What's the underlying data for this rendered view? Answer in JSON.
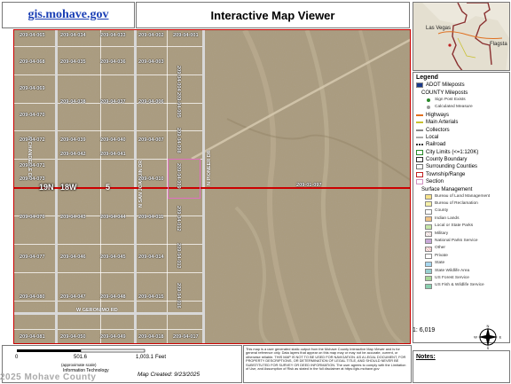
{
  "header": {
    "site_link": "gis.mohave.gov",
    "title": "Interactive Map Viewer"
  },
  "inset_map": {
    "labels": [
      "Las Vegas",
      "Flagsta"
    ]
  },
  "map": {
    "parcels": [
      {
        "id": "209-04-065"
      },
      {
        "id": "209-04-034"
      },
      {
        "id": "209-04-033"
      },
      {
        "id": "209-04-002"
      },
      {
        "id": "209-04-001"
      },
      {
        "id": "209-04-068"
      },
      {
        "id": "209-04-035"
      },
      {
        "id": "209-04-036"
      },
      {
        "id": "209-04-003"
      },
      {
        "id": "209-04-004"
      },
      {
        "id": "209-04-069"
      },
      {
        "id": "209-04-038"
      },
      {
        "id": "209-04-037"
      },
      {
        "id": "209-04-006"
      },
      {
        "id": "209-04-005"
      },
      {
        "id": "209-04-070"
      },
      {
        "id": "209-04-039"
      },
      {
        "id": "209-04-007"
      },
      {
        "id": "209-04-008"
      },
      {
        "id": "209-04-072"
      },
      {
        "id": "209-04-039"
      },
      {
        "id": "209-04-040"
      },
      {
        "id": "209-04-007"
      },
      {
        "id": "209-04-071"
      },
      {
        "id": "209-04-042"
      },
      {
        "id": "209-04-041"
      },
      {
        "id": "209-04-009"
      },
      {
        "id": "209-04-073"
      },
      {
        "id": "209-04-010"
      },
      {
        "id": "209-04-076"
      },
      {
        "id": "209-04-043"
      },
      {
        "id": "209-04-044"
      },
      {
        "id": "209-04-011"
      },
      {
        "id": "209-04-012"
      },
      {
        "id": "209-04-077"
      },
      {
        "id": "209-04-046"
      },
      {
        "id": "209-04-045"
      },
      {
        "id": "209-04-014"
      },
      {
        "id": "209-04-013"
      },
      {
        "id": "209-04-080"
      },
      {
        "id": "209-04-047"
      },
      {
        "id": "209-04-048"
      },
      {
        "id": "209-04-015"
      },
      {
        "id": "209-04-016"
      },
      {
        "id": "209-04-081"
      },
      {
        "id": "209-04-050"
      },
      {
        "id": "209-04-049"
      },
      {
        "id": "209-04-018"
      },
      {
        "id": "209-04-017"
      },
      {
        "id": "209-01-097"
      }
    ],
    "township": "19N",
    "range": "18W",
    "section": "5",
    "roads": {
      "road1": "W GERONIMO RD",
      "road2": "N CHANDELLE DR",
      "road3": "N SAN JOAQUIN DR",
      "road4": "N PIONEER DR"
    }
  },
  "legend": {
    "title": "Legend",
    "items": [
      {
        "label": "ADOT Mileposts",
        "color": "#1a3a8a",
        "kind": "sq"
      },
      {
        "label": "COUNTY Mileposts",
        "color": "",
        "kind": "text"
      },
      {
        "label": "Sign Post Exists",
        "color": "#2a8a2a",
        "kind": "dot",
        "sub": true
      },
      {
        "label": "Calculated Measure",
        "color": "#9a9a9a",
        "kind": "dot",
        "sub": true
      },
      {
        "label": "Highways",
        "color": "#e07020",
        "kind": "line"
      },
      {
        "label": "Main Arterials",
        "color": "#c8c030",
        "kind": "line"
      },
      {
        "label": "Collectors",
        "color": "#8a8a8a",
        "kind": "line"
      },
      {
        "label": "Local",
        "color": "#aaaaaa",
        "kind": "line"
      },
      {
        "label": "Railroad",
        "color": "#333333",
        "kind": "rail"
      },
      {
        "label": "City Limits (<=1:120K)",
        "color": "#2a8a2a",
        "kind": "box"
      },
      {
        "label": "County Boundary",
        "color": "#333333",
        "kind": "box"
      },
      {
        "label": "Surrounding Counties",
        "color": "#777777",
        "kind": "box"
      },
      {
        "label": "Township/Range",
        "color": "#c02020",
        "kind": "box"
      },
      {
        "label": "Section",
        "color": "#d090c0",
        "kind": "box"
      },
      {
        "label": "Surface Management",
        "color": "",
        "kind": "text"
      },
      {
        "label": "Bureau of Land Management",
        "color": "#f6e28a",
        "kind": "sq",
        "sub": true
      },
      {
        "label": "Bureau of Reclamation",
        "color": "#f6f0a8",
        "kind": "sq",
        "sub": true
      },
      {
        "label": "County",
        "color": "#ffffff",
        "kind": "sq",
        "sub": true
      },
      {
        "label": "Indian Lands",
        "color": "#f2c488",
        "kind": "sq",
        "sub": true
      },
      {
        "label": "Local or State Parks",
        "color": "#c6e6a8",
        "kind": "sq",
        "sub": true
      },
      {
        "label": "Military",
        "color": "#e8d0d0",
        "kind": "hatch",
        "sub": true
      },
      {
        "label": "National Parks Service",
        "color": "#c8a8d8",
        "kind": "sq",
        "sub": true
      },
      {
        "label": "Other",
        "color": "#e8b0b0",
        "kind": "hatch",
        "sub": true
      },
      {
        "label": "Private",
        "color": "#ffffff",
        "kind": "sq",
        "sub": true
      },
      {
        "label": "State",
        "color": "#a8d8f0",
        "kind": "sq",
        "sub": true
      },
      {
        "label": "State Wildlife Area",
        "color": "#98d0d0",
        "kind": "sq",
        "sub": true
      },
      {
        "label": "US Forest Service",
        "color": "#a8d898",
        "kind": "sq",
        "sub": true
      },
      {
        "label": "US Fish & Wildlife Service",
        "color": "#8ad0b0",
        "kind": "sq",
        "sub": true
      }
    ]
  },
  "scale": {
    "ratio": "1: 6,019",
    "ticks": [
      "0",
      "501.6",
      "1,003.1"
    ],
    "unit": "Feet",
    "note": "(approximate scale)"
  },
  "footer": {
    "created": "Map Created: 9/23/2025",
    "org": "Information Technology",
    "watermark": "2025 Mohave County",
    "disclaimer": "This map is a user generated static output from the Mohave County Interactive Map Viewer and is for general reference only. Data layers that appear on this map may or may not be accurate, current, or otherwise reliable. THIS MAP IS NOT TO BE USED FOR NAVIGATION. AS A LEGAL DOCUMENT, FOR PROPERTY DESCRIPTIONS, OR DETERMINATION OF LEGAL TITLE, AND SHOULD NEVER BE SUBSTITUTED FOR SURVEY OR DEED INFORMATION. The user agrees to comply with the Limitation of Use, and Assumption of Risk as stated in the full disclaimer at https://gis.mohave.gov",
    "notes_label": "Notes:"
  },
  "colors": {
    "boundary": "#cc0000",
    "link": "#1a3fb5",
    "terrain": "#a89878"
  }
}
